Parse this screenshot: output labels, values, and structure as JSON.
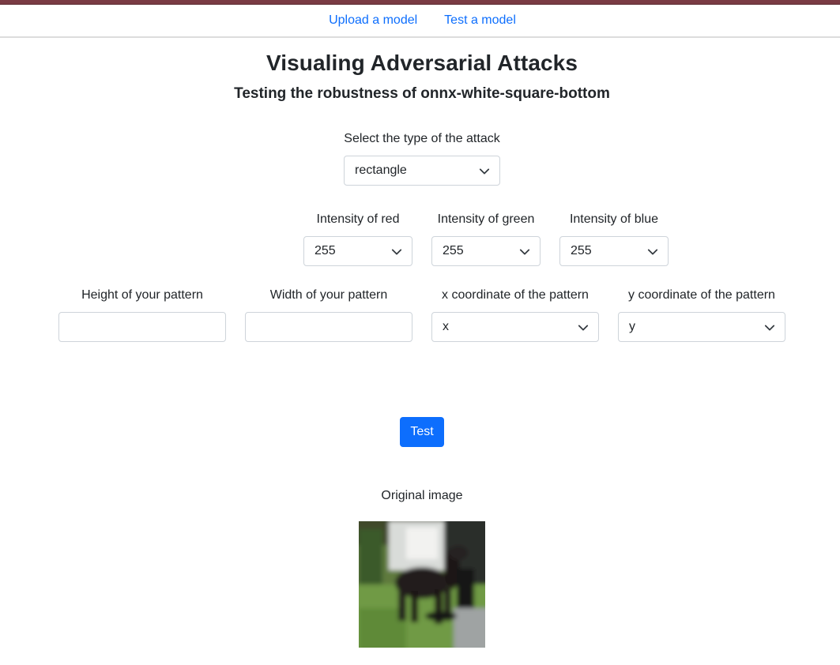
{
  "nav": {
    "upload": "Upload a model",
    "test": "Test a model"
  },
  "header": {
    "title": "Visualing Adversarial Attacks",
    "subtitle": "Testing the robustness of onnx-white-square-bottom"
  },
  "attack": {
    "label": "Select the type of the attack",
    "selected": "rectangle"
  },
  "colors": {
    "red_label": "Intensity of red",
    "red_value": "255",
    "green_label": "Intensity of green",
    "green_value": "255",
    "blue_label": "Intensity of blue",
    "blue_value": "255"
  },
  "pattern": {
    "height_label": "Height of your pattern",
    "height_value": "",
    "width_label": "Width of your pattern",
    "width_value": "",
    "x_label": "x coordinate of the pattern",
    "x_value": "x",
    "y_label": "y coordinate of the pattern",
    "y_value": "y"
  },
  "actions": {
    "test_label": "Test"
  },
  "image": {
    "label": "Original image"
  },
  "theme": {
    "accent": "#0d6efd",
    "topbar": "#7a3b44"
  }
}
